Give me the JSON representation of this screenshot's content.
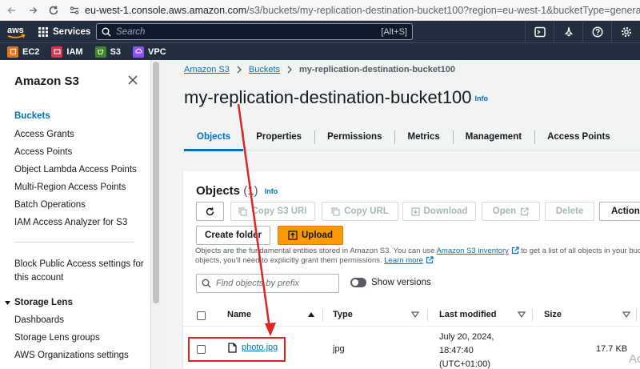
{
  "browser": {
    "url_host": "eu-west-1.console.aws.amazon.com",
    "url_path": "/s3/buckets/my-replication-destination-bucket100?region=eu-west-1&bucketType=general&tab=objects"
  },
  "topnav": {
    "logo": "aws",
    "services_label": "Services",
    "search_placeholder": "Search",
    "search_shortcut": "[Alt+S]",
    "icons": [
      "cloudshell-icon",
      "bell-icon",
      "help-icon",
      "gear-icon"
    ]
  },
  "favorites": [
    {
      "label": "EC2",
      "color": "#ec7211"
    },
    {
      "label": "IAM",
      "color": "#dd344c"
    },
    {
      "label": "S3",
      "color": "#3f8624"
    },
    {
      "label": "VPC",
      "color": "#8c4fff"
    }
  ],
  "sidebar": {
    "title": "Amazon S3",
    "items": [
      {
        "label": "Buckets",
        "active": true
      },
      {
        "label": "Access Grants"
      },
      {
        "label": "Access Points"
      },
      {
        "label": "Object Lambda Access Points"
      },
      {
        "label": "Multi-Region Access Points"
      },
      {
        "label": "Batch Operations"
      },
      {
        "label": "IAM Access Analyzer for S3"
      }
    ],
    "block_public_line1": "Block Public Access settings for",
    "block_public_line2": "this account",
    "storage_lens": {
      "label": "Storage Lens",
      "items": [
        "Dashboards",
        "Storage Lens groups",
        "AWS Organizations settings"
      ]
    }
  },
  "breadcrumb": {
    "items": [
      "Amazon S3",
      "Buckets",
      "my-replication-destination-bucket100"
    ]
  },
  "page": {
    "title": "my-replication-destination-bucket100",
    "info": "Info"
  },
  "tabs": [
    {
      "label": "Objects",
      "active": true
    },
    {
      "label": "Properties"
    },
    {
      "label": "Permissions"
    },
    {
      "label": "Metrics"
    },
    {
      "label": "Management"
    },
    {
      "label": "Access Points"
    }
  ],
  "objects": {
    "heading": "Objects",
    "count": "(1)",
    "info": "Info",
    "buttons": {
      "copy_s3_uri": "Copy S3 URI",
      "copy_url": "Copy URL",
      "download": "Download",
      "open": "Open",
      "delete": "Delete",
      "actions": "Actions",
      "create_folder": "Create folder",
      "upload": "Upload"
    },
    "description_1": "Objects are the fundamental entities stored in Amazon S3. You can use",
    "inventory_link": "Amazon S3 inventory",
    "description_2": "to get a list of all objects in your bucket. F",
    "description_3": "objects, you'll need to explicitly grant them permissions.",
    "learn_more": "Learn more",
    "search_placeholder": "Find objects by prefix",
    "show_versions": "Show versions",
    "columns": [
      "Name",
      "Type",
      "Last modified",
      "Size"
    ],
    "rows": [
      {
        "name": "photo.jpg",
        "type": "jpg",
        "modified_1": "July 20, 2024,",
        "modified_2": "18:47:40",
        "modified_3": "(UTC+01:00)",
        "size": "17.7 KB"
      }
    ]
  },
  "annotation_color": "#e02424",
  "watermark": "Ac"
}
